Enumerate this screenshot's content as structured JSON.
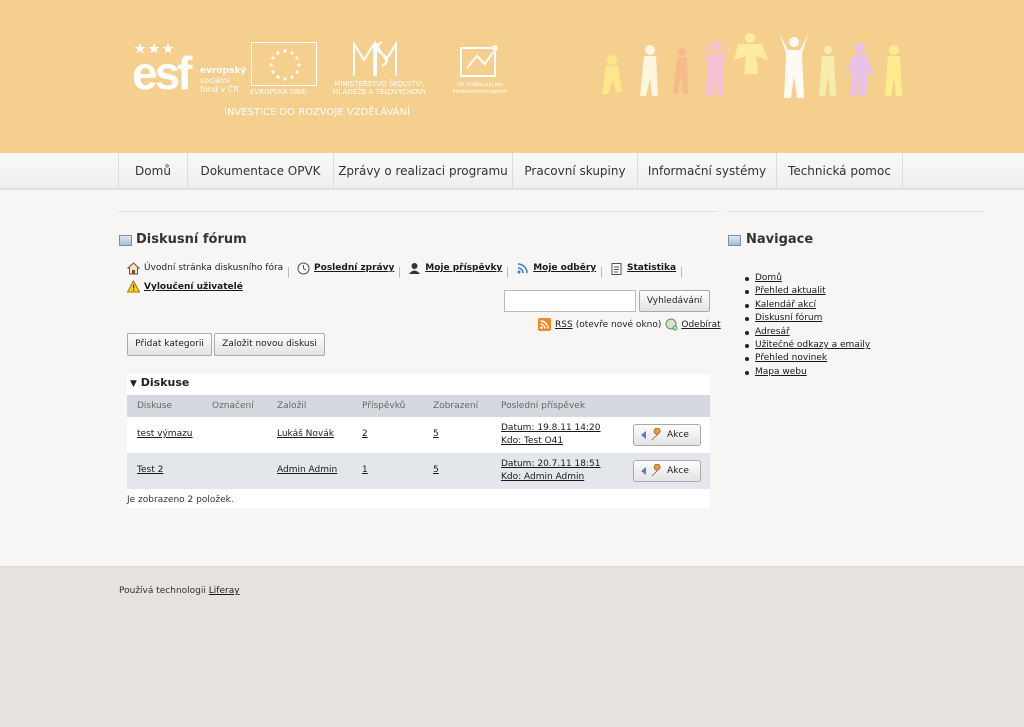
{
  "header": {
    "esf": {
      "big": "esf",
      "line1": "evropský",
      "line2": "sociální",
      "line3": "fond v ČR"
    },
    "eu_label": "EVROPSKÁ UNIE",
    "msmt_label": "MINISTERSTVO ŠKOLSTVÍ, MLÁDEŽE A TĚLOVÝCHOVY",
    "op_label": "OP Vzdělávání pro konkurenceschopnost",
    "tagline": "INVESTICE DO ROZVOJE VZDĚLÁVÁNÍ",
    "bg_color": "#f5cf8e"
  },
  "nav": {
    "items": [
      "Domů",
      "Dokumentace OPVK",
      "Zprávy o realizaci programu",
      "Pracovní skupiny",
      "Informační systémy",
      "Technická pomoc"
    ]
  },
  "forum": {
    "title": "Diskusní fórum",
    "toolbar": {
      "home": "Úvodní stránka diskusního fóra",
      "recent": "Poslední zprávy",
      "my_posts": "Moje příspěvky",
      "subs": "Moje odběry",
      "stats": "Statistika",
      "banned": "Vyloučení uživatelé"
    },
    "search_button": "Vyhledávání",
    "search_value": "",
    "rss": {
      "link": "RSS",
      "note": "(otevře nové okno)",
      "subscribe": "Odebírat"
    },
    "add_category": "Přidat kategorii",
    "new_discussion": "Založit novou diskusi",
    "section_title": "Diskuse",
    "columns": [
      "Diskuse",
      "Označení",
      "Založil",
      "Příspěvků",
      "Zobrazení",
      "Poslední příspěvek"
    ],
    "rows": [
      {
        "name": "test výmazu",
        "tag": "",
        "author": "Lukáš Novák",
        "posts": "2",
        "views": "5",
        "last_date": "Datum: 19.8.11 14:20",
        "last_by": "Kdo: Test O41",
        "action": "Akce"
      },
      {
        "name": "Test 2",
        "tag": "",
        "author": "Admin Admin",
        "posts": "1",
        "views": "5",
        "last_date": "Datum: 20.7.11 18:51",
        "last_by": "Kdo: Admin Admin",
        "action": "Akce"
      }
    ],
    "count_text": "Je zobrazeno 2 položek."
  },
  "sidebar": {
    "title": "Navigace",
    "items": [
      "Domů",
      "Přehled aktualit",
      "Kalendář akcí",
      "Diskusní fórum",
      "Adresář",
      "Užitečné odkazy a emaily",
      "Přehled novinek",
      "Mapa webu"
    ]
  },
  "footer": {
    "prefix": "Používá technologii",
    "link": "Liferay"
  }
}
